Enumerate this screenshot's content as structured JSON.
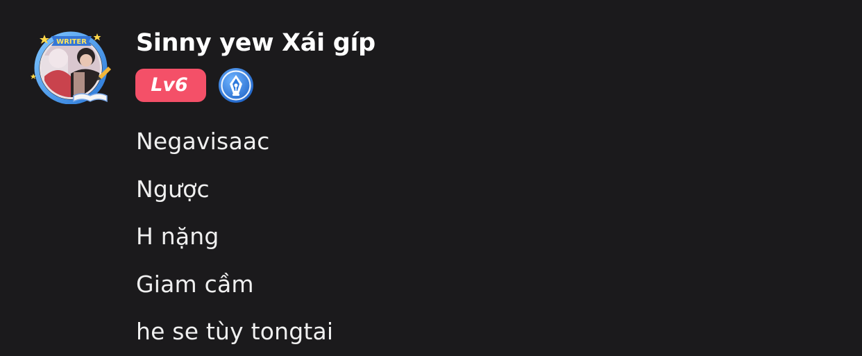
{
  "comment": {
    "author": {
      "name": "Sinny yew Xái gíp",
      "frame_label": "WRITER",
      "avatar_icon": "writer-frame-avatar",
      "level_label": "Lv6",
      "level_color": "#f45068",
      "verified_icon": "fountain-pen-nib-icon",
      "verified_color": "#2f7fe0"
    },
    "lines": [
      "Negavisaac",
      "Ngược",
      "H nặng",
      "Giam cầm",
      "he se tùy tongtai"
    ]
  },
  "theme": {
    "background": "#1b1a1c",
    "text": "#f0f0f0"
  }
}
